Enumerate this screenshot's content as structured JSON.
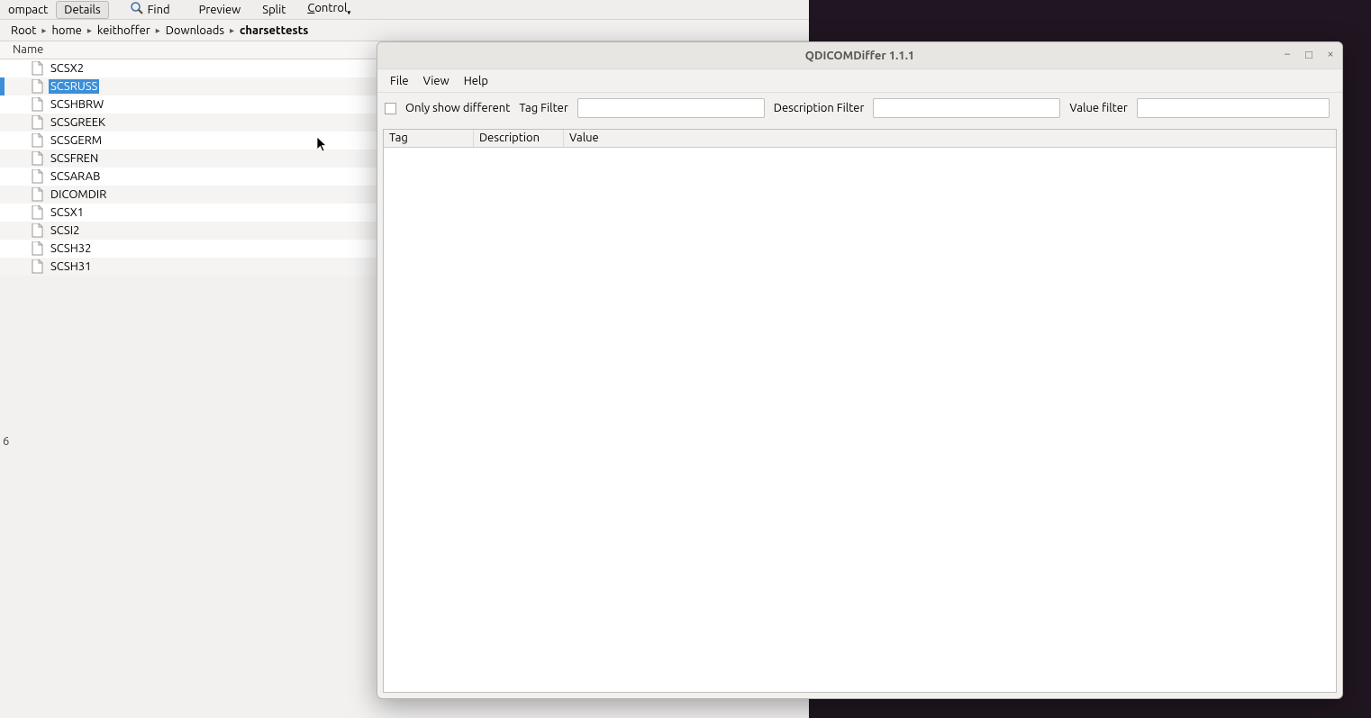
{
  "fm": {
    "toolbar": {
      "compact": "ompact",
      "details": "Details",
      "find": "Find",
      "preview": "Preview",
      "split": "Split",
      "control": "Control"
    },
    "breadcrumb": [
      "Root",
      "home",
      "keithoffer",
      "Downloads",
      "charsettests"
    ],
    "header": "Name",
    "files": [
      {
        "name": "SCSX2"
      },
      {
        "name": "SCSRUSS",
        "selected": true
      },
      {
        "name": "SCSHBRW"
      },
      {
        "name": "SCSGREEK"
      },
      {
        "name": "SCSGERM"
      },
      {
        "name": "SCSFREN"
      },
      {
        "name": "SCSARAB"
      },
      {
        "name": "DICOMDIR"
      },
      {
        "name": "SCSX1"
      },
      {
        "name": "SCSI2"
      },
      {
        "name": "SCSH32"
      },
      {
        "name": "SCSH31"
      }
    ],
    "side_label": "6"
  },
  "app": {
    "title": "QDICOMDiffer 1.1.1",
    "menu": {
      "file": "File",
      "view": "View",
      "help": "Help"
    },
    "filter": {
      "only_diff": "Only show different",
      "tag_label": "Tag Filter",
      "desc_label": "Description Filter",
      "value_label": "Value filter",
      "tag_value": "",
      "desc_value": "",
      "value_value": ""
    },
    "columns": {
      "tag": "Tag",
      "description": "Description",
      "value": "Value"
    }
  }
}
